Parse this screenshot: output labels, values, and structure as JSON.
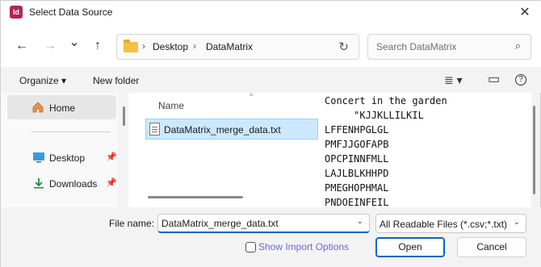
{
  "window": {
    "title": "Select Data Source",
    "app_icon_text": "Id",
    "close_symbol": "✕"
  },
  "nav": {
    "back_symbol": "←",
    "forward_symbol": "→",
    "recent_symbol": "⌄",
    "up_symbol": "↑",
    "breadcrumbs": [
      "Desktop",
      "DataMatrix"
    ],
    "separator": "›",
    "refresh_symbol": "↻",
    "search_placeholder": "Search DataMatrix",
    "search_symbol": "⌕"
  },
  "toolbar": {
    "organize_label": "Organize ▾",
    "new_folder_label": "New folder",
    "view_symbol": "≣ ▾",
    "preview_pane_symbol": "▭",
    "help_symbol": "?"
  },
  "sidebar": {
    "home_label": "Home",
    "items": [
      {
        "label": "Desktop",
        "icon": "desktop-icon",
        "pin": "📌"
      },
      {
        "label": "Downloads",
        "icon": "downloads-icon",
        "pin": "📌"
      }
    ]
  },
  "filelist": {
    "column_name": "Name",
    "sort_symbol": "^",
    "files": [
      {
        "name": "DataMatrix_merge_data.txt",
        "selected": true
      }
    ]
  },
  "preview": {
    "lines": [
      "Concert in the garden",
      "     \"KJJKLLILKIL",
      "LFFENHPGLGL",
      "PMFJJGOFAPB",
      "OPCPINNFMLL",
      "LAJLBLKHHPD",
      "PMEGHOPHMAL",
      "PNDOEINFEIL"
    ]
  },
  "bottom": {
    "file_name_label": "File name:",
    "file_name_value": "DataMatrix_merge_data.txt",
    "filter_value": "All Readable Files (*.csv;*.txt)",
    "chevron": "⌄",
    "show_import_options_label": "Show Import Options",
    "open_label": "Open",
    "cancel_label": "Cancel"
  },
  "colors": {
    "accent": "#0067c0",
    "selection": "#cce8ff",
    "link": "#6b6bd6"
  }
}
